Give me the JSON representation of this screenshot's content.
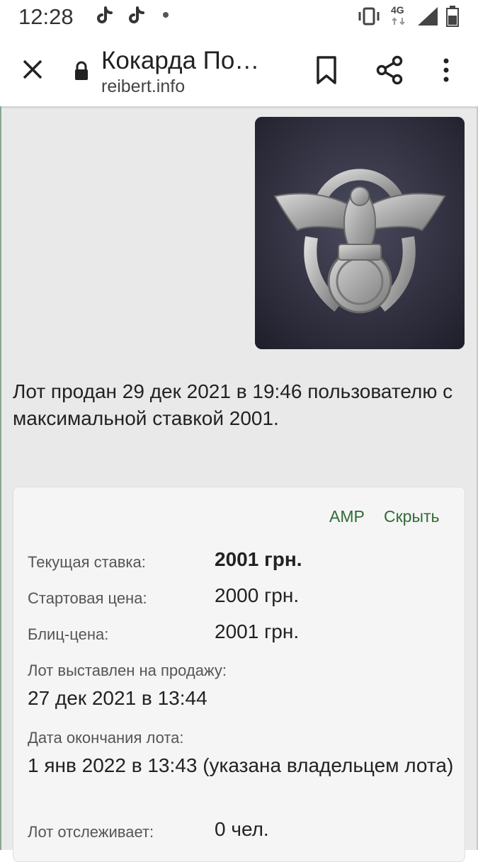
{
  "status_bar": {
    "time": "12:28",
    "network": "4G",
    "icons": [
      "tiktok-icon",
      "tiktok-icon",
      "notification-dot-icon",
      "vibrate-icon",
      "signal-icon",
      "battery-icon"
    ]
  },
  "toolbar": {
    "title": "Кокарда По…",
    "url": "reibert.info",
    "icons": [
      "close-icon",
      "lock-icon",
      "bookmark-icon",
      "share-icon",
      "more-vert-icon"
    ]
  },
  "photo": {
    "alt": "eagle-badge-photo"
  },
  "sold_text": "Лот продан 29 дек 2021 в 19:46 пользователю с максимальной ставкой 2001.",
  "card": {
    "amp_label": "AMP",
    "hide_label": "Скрыть",
    "current_bid_label": "Текущая ставка:",
    "current_bid_value": "2001 грн.",
    "start_price_label": "Стартовая цена:",
    "start_price_value": "2000 грн.",
    "blitz_label": "Блиц-цена:",
    "blitz_value": "2001 грн.",
    "listed_label": "Лот выставлен на продажу:",
    "listed_value": "27 дек 2021 в 13:44",
    "end_label": "Дата окончания лота:",
    "end_value": "1 янв 2022 в 13:43 (указана владельцем лота)",
    "watchers_label": "Лот отслеживает:",
    "watchers_value": "0 чел."
  },
  "colors": {
    "link_green": "#2e6b34",
    "page_bg": "#e9e9e9",
    "card_bg": "#f5f5f5"
  }
}
